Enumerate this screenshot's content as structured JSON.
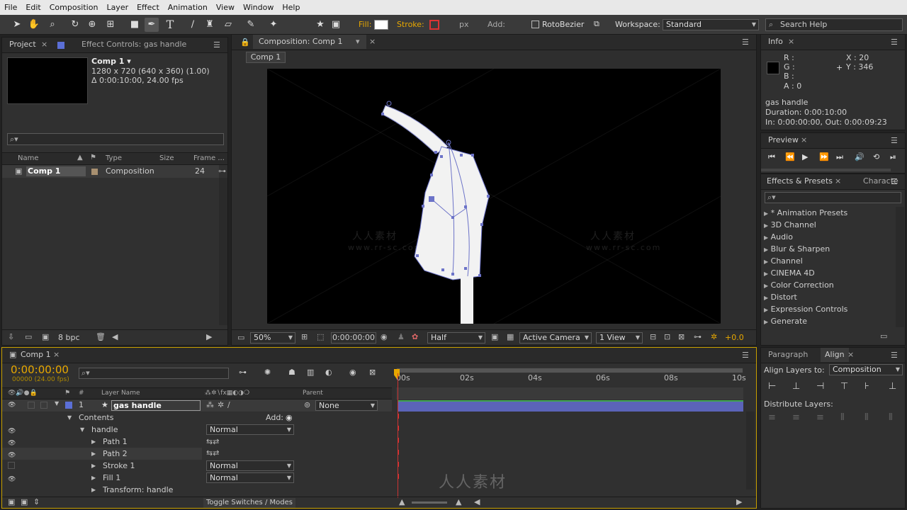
{
  "menu": [
    "File",
    "Edit",
    "Composition",
    "Layer",
    "Effect",
    "Animation",
    "View",
    "Window",
    "Help"
  ],
  "toolbar": {
    "fill_label": "Fill:",
    "stroke_label": "Stroke:",
    "px_label": "px",
    "add_label": "Add:",
    "rotobezier_label": "RotoBezier",
    "workspace_label": "Workspace:",
    "workspace_value": "Standard",
    "search_placeholder": "Search Help"
  },
  "watermark": "www.rr-sc.com",
  "watermark_cn": "人人素材",
  "project": {
    "tab_project": "Project",
    "tab_effect": "Effect Controls: gas handle",
    "comp_name": "Comp 1 ▾",
    "comp_res": "1280 x 720  (640 x 360) (1.00)",
    "comp_dur": "Δ 0:00:10:00, 24.00 fps",
    "col_name": "Name",
    "col_type": "Type",
    "col_size": "Size",
    "col_frame": "Frame ...",
    "item_name": "Comp 1",
    "item_type": "Composition",
    "item_frame": "24",
    "bpc": "8 bpc"
  },
  "composition": {
    "tab": "Composition: Comp 1",
    "breadcrumb": "Comp 1",
    "zoom": "50%",
    "timecode": "0:00:00:00",
    "resolution": "Half",
    "camera": "Active Camera",
    "views": "1 View",
    "exposure": "+0.0"
  },
  "info": {
    "tab": "Info",
    "r": "R :",
    "g": "G :",
    "b": "B :",
    "a": "A : 0",
    "x": "X : 20",
    "y": "Y : 346",
    "layer": "gas handle",
    "duration": "Duration: 0:00:10:00",
    "inout": "In: 0:00:00:00, Out: 0:00:09:23"
  },
  "preview": {
    "tab": "Preview"
  },
  "effects": {
    "tab": "Effects & Presets",
    "tab2": "Characte",
    "items": [
      "* Animation Presets",
      "3D Channel",
      "Audio",
      "Blur & Sharpen",
      "Channel",
      "CINEMA 4D",
      "Color Correction",
      "Distort",
      "Expression Controls",
      "Generate"
    ]
  },
  "timeline": {
    "tab": "Comp 1",
    "timecode": "0:00:00:00",
    "fps": "00000 (24.00 fps)",
    "col_layer": "Layer Name",
    "col_parent": "Parent",
    "ruler": [
      "00s",
      "02s",
      "04s",
      "06s",
      "08s",
      "10s"
    ],
    "layer_num": "1",
    "layer_name": "gas handle",
    "parent": "None",
    "rows": [
      {
        "label": "Contents",
        "indent": 1,
        "add": "Add:"
      },
      {
        "label": "handle",
        "indent": 2,
        "mode": "Normal"
      },
      {
        "label": "Path 1",
        "indent": 3
      },
      {
        "label": "Path 2",
        "indent": 3
      },
      {
        "label": "Stroke 1",
        "indent": 3,
        "mode": "Normal"
      },
      {
        "label": "Fill 1",
        "indent": 3,
        "mode": "Normal"
      },
      {
        "label": "Transform: handle",
        "indent": 3
      }
    ],
    "toggle": "Toggle Switches / Modes"
  },
  "paragraph": {
    "tab": "Paragraph"
  },
  "align": {
    "tab": "Align",
    "layers_to": "Align Layers to:",
    "target": "Composition",
    "distribute": "Distribute Layers:"
  }
}
